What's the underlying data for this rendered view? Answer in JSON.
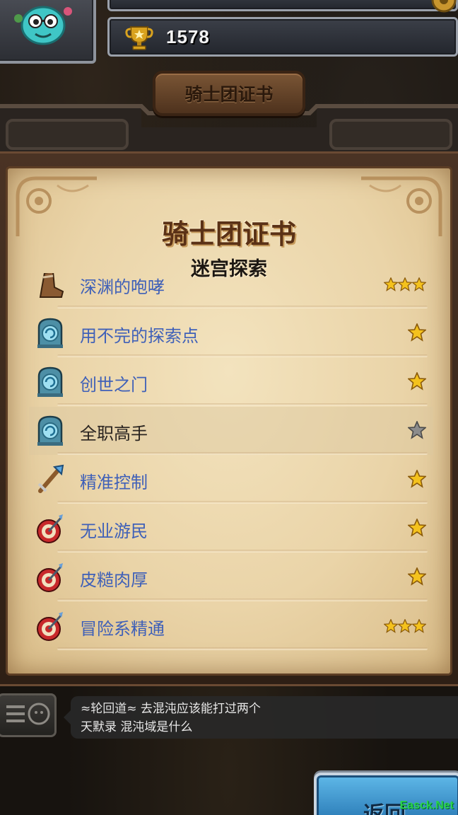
{
  "hud": {
    "trophy_count": "1578"
  },
  "header": {
    "banner_title": "骑士团证书"
  },
  "certificate": {
    "title": "骑士团证书",
    "subtitle": "迷宫探索",
    "items": [
      {
        "label": "深渊的咆哮",
        "icon": "boot-icon",
        "stars": 3,
        "star_color": "gold"
      },
      {
        "label": "用不完的探索点",
        "icon": "portal-icon",
        "stars": 1,
        "star_color": "gold"
      },
      {
        "label": "创世之门",
        "icon": "portal-icon",
        "stars": 1,
        "star_color": "gold"
      },
      {
        "label": "全职高手",
        "icon": "portal-icon",
        "stars": 1,
        "star_color": "gray",
        "selected": true
      },
      {
        "label": "精准控制",
        "icon": "sword-icon",
        "stars": 1,
        "star_color": "gold"
      },
      {
        "label": "无业游民",
        "icon": "target-icon",
        "stars": 1,
        "star_color": "gold"
      },
      {
        "label": "皮糙肉厚",
        "icon": "target-icon",
        "stars": 1,
        "star_color": "gold"
      },
      {
        "label": "冒险系精通",
        "icon": "target-icon",
        "stars": 3,
        "star_color": "gold"
      }
    ]
  },
  "chat": {
    "sender": "≈轮回道≈",
    "message_line1": "去混沌应该能打过两个",
    "message_line2": "天默录  混沌域是什么"
  },
  "return_button": {
    "label": "返回"
  },
  "watermark": "Easck.Net",
  "colors": {
    "link_blue": "#3f60b8",
    "star_gold": "#f4c21d",
    "star_gray": "#8c8c8c",
    "parchment": "#ead4a8"
  }
}
